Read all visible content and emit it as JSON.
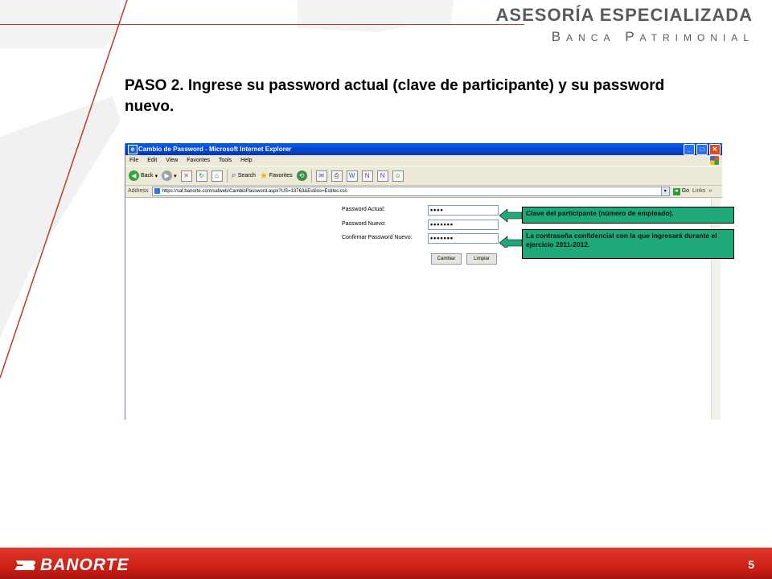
{
  "brand": {
    "title": "ASESORÍA ESPECIALIZADA",
    "subtitle": "Banca Patrimonial"
  },
  "step_title": "PASO 2. Ingrese su password actual (clave de participante) y su password nuevo.",
  "browser": {
    "window_title": "Cambio de Password - Microsoft Internet Explorer",
    "menu": [
      "File",
      "Edit",
      "View",
      "Favorites",
      "Tools",
      "Help"
    ],
    "toolbar": {
      "back": "Back",
      "search": "Search",
      "favorites": "Favorites"
    },
    "address_label": "Address",
    "address_value": "https://saf.banorte.com/safweb/CambioPassword.aspx?US=13763&Estilos=Estilos.css",
    "go_label": "Go",
    "links_label": "Links"
  },
  "form": {
    "current_label": "Password Actual:",
    "current_value": "••••",
    "new_label": "Password Nuevo:",
    "new_value": "•••••••",
    "confirm_label": "Confirmar Password Nuevo:",
    "confirm_value": "•••••••",
    "change_button": "Cambiar",
    "clear_button": "Limpiar"
  },
  "callouts": {
    "first": "Clave del participante (número de empleado).",
    "second": "La contraseña confidencial con la que ingresará durante el ejercicio 2011-2012."
  },
  "footer": {
    "logo": "BANORTE",
    "page_number": "5"
  },
  "colors": {
    "accent_red": "#c81d16",
    "callout_green": "#1fa978",
    "xp_blue": "#0a5de8"
  }
}
